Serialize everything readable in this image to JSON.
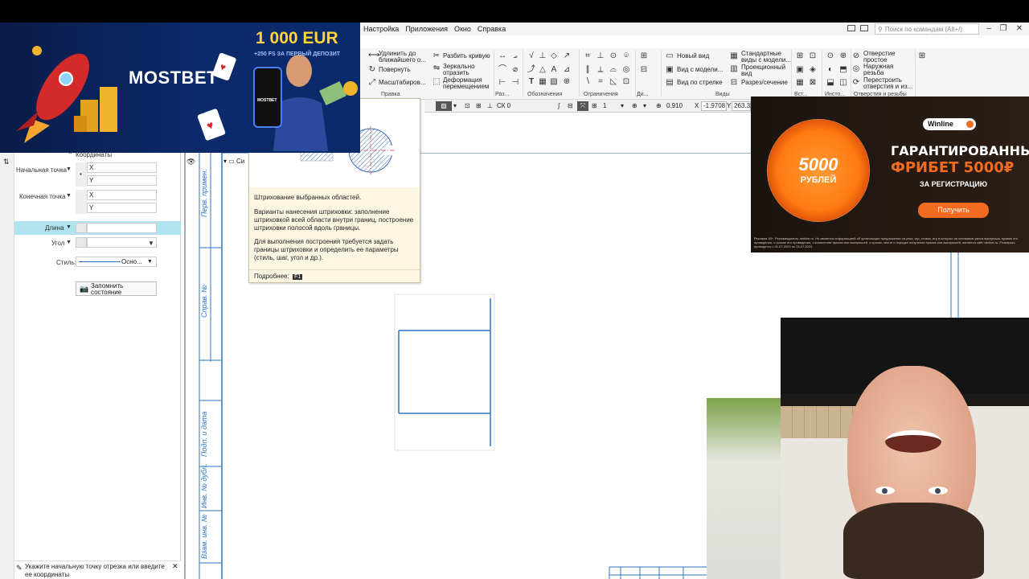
{
  "menu": {
    "items": [
      "Настройка",
      "Приложения",
      "Окно",
      "Справка"
    ],
    "search_placeholder": "Поиск по командам (Alt+/)"
  },
  "ribbon": {
    "group1": {
      "extend": "Удлинить до ближайшего о...",
      "rotate": "Повернуть",
      "scale": "Масштабиров...",
      "split_curve": "Разбить кривую",
      "mirror": "Зеркально отразить",
      "deform": "Деформация перемещением",
      "label": "Правка"
    },
    "group_labels": {
      "razm": "Раз...",
      "oboznach": "Обозначения",
      "ogranich": "Ограничения",
      "di": "Ди...",
      "vidy": "Виды",
      "vst": "Вст...",
      "insto": "Инсто...",
      "otverstiya": "Отверстия и резьбы"
    },
    "views": {
      "new_view": "Новый вид",
      "model_view": "Вид с модели...",
      "arrow_view": "Вид по стрелке",
      "standard_views": "Стандартные виды с модели...",
      "projection_view": "Проекционный вид",
      "section": "Разрез/сечение"
    },
    "holes": {
      "simple_hole": "Отверстие простое",
      "outer_thread": "Наружная резьба",
      "rebuild": "Перестроить отверстия и из..."
    }
  },
  "toolbar2": {
    "cs": "СК 0",
    "scale": "1",
    "zoom": "0.910",
    "x_label": "X",
    "x_value": "-1.9708",
    "y_label": "Y",
    "y_value": "263.32"
  },
  "panel": {
    "section_title": "Координаты",
    "start_point_label": "Начальная точка",
    "end_point_label": "Конечная точка",
    "x_label": "X",
    "y_label": "Y",
    "length_label": "Длина",
    "angle_label": "Угол",
    "style_label": "Стиль:",
    "style_value": "Осно...",
    "remember_button": "Запомнить состояние",
    "status_text": "Укажите начальную точку отрезка или введите ее координаты"
  },
  "tooltip": {
    "title": "Штрихование выбранных областей.",
    "para1": "Варианты нанесения штриховки: заполнение штриховкой всей области внутри границ, построение штриховки полосой вдоль границы.",
    "para2": "Для выполнения построения требуется задать границы штриховки и определить ее параметры (стиль, шаг, угол и др.).",
    "more": "Подробнее:",
    "key": "F1"
  },
  "drawing": {
    "stamp1": "Перв. примен.",
    "stamp2": "Справ. №",
    "stamp3": "Подп. и дата",
    "stamp4": "Инв. № дубл.",
    "stamp5": "Взам. инв. №",
    "stamp6": "Подп. и дата",
    "tree_item": "Си"
  },
  "ads": {
    "mostbet": {
      "logo": "MOSTBET",
      "amount": "1 000 EUR",
      "subtitle": "+250 FS ЗА ПЕРВЫЙ ДЕПОЗИТ",
      "phone_text": "MOSTBET"
    },
    "winline": {
      "logo": "Winline",
      "chip_number": "5000",
      "chip_text": "РУБЛЕЙ",
      "title1": "ГАРАНТИРОВАННЫЙ",
      "title2": "ФРИБЕТ 5000₽",
      "subtitle": "ЗА РЕГИСТРАЦИЮ",
      "button": "Получить",
      "legal": "Реклама 18+. Рекламодатель: winline.ru. Не является информацией об организации предложения на риск, игр, ставок, игр в которых на основании риска выигрыша, правил его проведения, о сроках его проведения, о количестве призов или выигрышей, о сроках, месте и порядке получения призов или выигрышей, является сайт winline.ru. Розыгрыш проводится с 01.07.2023 по 23.07.2023."
    }
  },
  "colors": {
    "drawing_line": "#2d74c0",
    "ribbon_bg": "#f5f5f5",
    "highlight_row": "#aee3ef",
    "winline_orange": "#f26b21",
    "mostbet_gold": "#ffd43a"
  }
}
